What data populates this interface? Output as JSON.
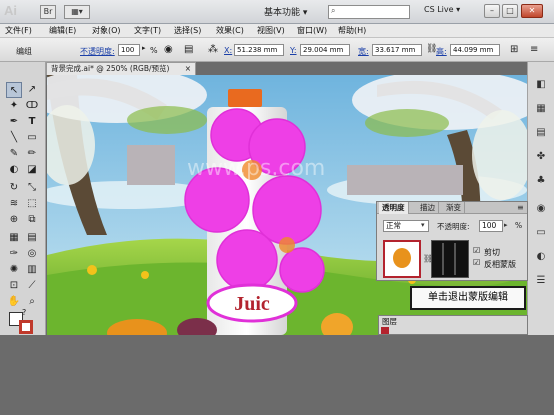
{
  "app": {
    "logo_text": "Ai"
  },
  "titlebar": {
    "workspace": "基本功能 ▾",
    "cs_live": "CS Live ▾",
    "window_buttons": {
      "min": "–",
      "max": "□",
      "close": "✕"
    }
  },
  "menu": [
    "文件(F)",
    "编辑(E)",
    "对象(O)",
    "文字(T)",
    "选择(S)",
    "效果(C)",
    "视图(V)",
    "窗口(W)",
    "帮助(H)"
  ],
  "control_bar": {
    "mode_label": "编组",
    "opacity_label": "不透明度:",
    "opacity_value": "100",
    "percent": "%",
    "x_label": "X:",
    "x_value": "51.238 mm",
    "y_label": "Y:",
    "y_value": "29.004 mm",
    "w_label": "宽:",
    "w_value": "33.617 mm",
    "h_label": "高:",
    "h_value": "44.099 mm"
  },
  "document": {
    "tab_title": "背景完成.ai* @ 250% (RGB/预览)",
    "tab_close": "×"
  },
  "artwork": {
    "juice_text": "Juic",
    "watermark": "www.ps.com"
  },
  "transparency_panel": {
    "tabs": [
      "透明度",
      "描边",
      "渐变"
    ],
    "blend_mode": "正常",
    "opacity_label": "不透明度:",
    "opacity_value": "100",
    "percent": "%",
    "clip_label": "剪切",
    "invert_label": "反相蒙版"
  },
  "callout": {
    "text": "单击退出蒙版编辑"
  },
  "layers_panel": {
    "title": "图层"
  },
  "colors": {
    "magenta": "#ee3fe6",
    "sky": "#9ccfe8",
    "grass": "#7bc23a"
  }
}
